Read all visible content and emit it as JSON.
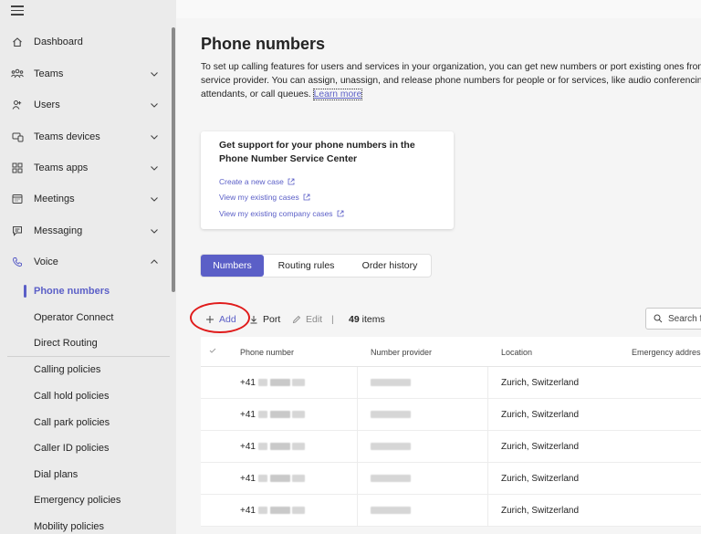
{
  "sidebar": {
    "items": [
      {
        "label": "Dashboard",
        "icon": "home-icon",
        "chevron": ""
      },
      {
        "label": "Teams",
        "icon": "teams-icon",
        "chevron": "down"
      },
      {
        "label": "Users",
        "icon": "users-icon",
        "chevron": "down"
      },
      {
        "label": "Teams devices",
        "icon": "devices-icon",
        "chevron": "down"
      },
      {
        "label": "Teams apps",
        "icon": "apps-icon",
        "chevron": "down"
      },
      {
        "label": "Meetings",
        "icon": "calendar-icon",
        "chevron": "down"
      },
      {
        "label": "Messaging",
        "icon": "chat-icon",
        "chevron": "down"
      },
      {
        "label": "Voice",
        "icon": "phone-icon",
        "chevron": "up"
      }
    ],
    "voice_sub": [
      {
        "label": "Phone numbers",
        "active": true
      },
      {
        "label": "Operator Connect"
      },
      {
        "label": "Direct Routing"
      },
      {
        "label": "Calling policies"
      },
      {
        "label": "Call hold policies"
      },
      {
        "label": "Call park policies"
      },
      {
        "label": "Caller ID policies"
      },
      {
        "label": "Dial plans"
      },
      {
        "label": "Emergency policies"
      },
      {
        "label": "Mobility policies"
      }
    ]
  },
  "page": {
    "title": "Phone numbers",
    "desc_line1": "To set up calling features for users and services in your organization, you can get new numbers or port existing ones from a",
    "desc_line2": "service provider. You can assign, unassign, and release phone numbers for people or for services, like audio conferencing, au",
    "desc_line3": "attendants, or call queues.",
    "learn_more": "Learn more"
  },
  "support_card": {
    "title": "Get support for your phone numbers in the Phone Number Service Center",
    "links": [
      "Create a new case",
      "View my existing cases",
      "View my existing company cases"
    ]
  },
  "tabs": [
    {
      "label": "Numbers",
      "active": true
    },
    {
      "label": "Routing rules"
    },
    {
      "label": "Order history"
    }
  ],
  "toolbar": {
    "add": "Add",
    "port": "Port",
    "edit": "Edit",
    "separator": "|",
    "count": "49",
    "count_suffix": "items",
    "search_placeholder": "Search fo"
  },
  "table": {
    "headers": [
      "Phone number",
      "Number provider",
      "Location",
      "Emergency address"
    ],
    "rows": [
      {
        "phone_prefix": "+41",
        "location": "Zurich, Switzerland"
      },
      {
        "phone_prefix": "+41",
        "location": "Zurich, Switzerland"
      },
      {
        "phone_prefix": "+41",
        "location": "Zurich, Switzerland"
      },
      {
        "phone_prefix": "+41",
        "location": "Zurich, Switzerland"
      },
      {
        "phone_prefix": "+41",
        "location": "Zurich, Switzerland"
      }
    ]
  },
  "colors": {
    "accent": "#5b5fc7",
    "highlight": "#e01b1b"
  }
}
